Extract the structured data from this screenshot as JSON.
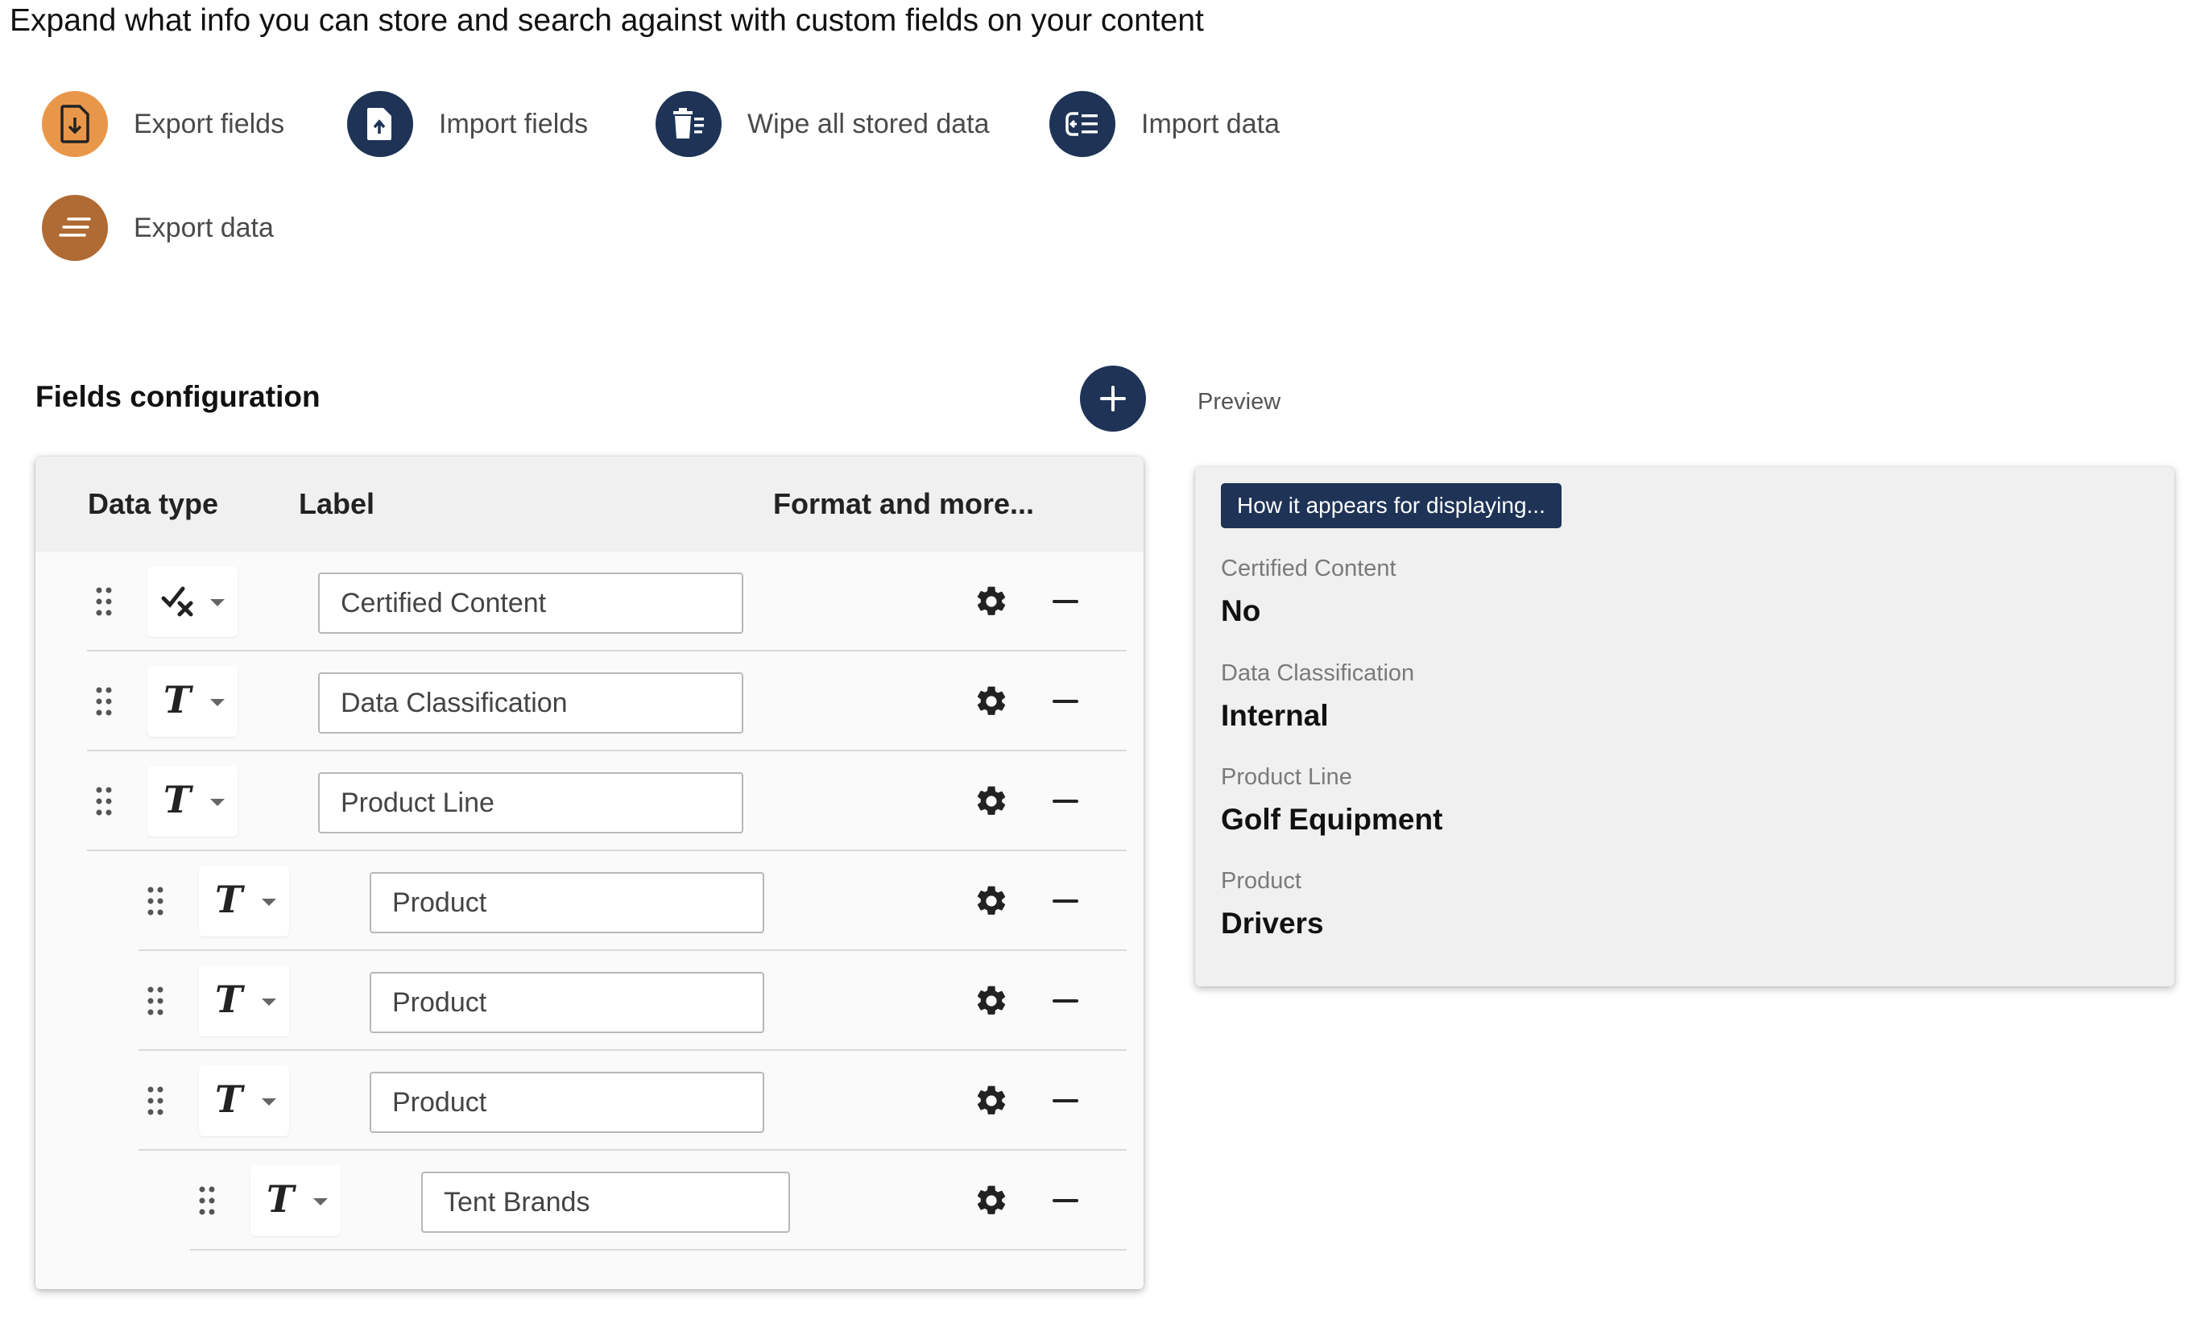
{
  "headline": "Expand what info you can store and search against with custom fields on your content",
  "actions": [
    {
      "label": "Export fields",
      "icon": "file-download-icon",
      "color": "#e8974a"
    },
    {
      "label": "Import fields",
      "icon": "file-upload-icon",
      "color": "#1e3356"
    },
    {
      "label": "Wipe all stored data",
      "icon": "trash-list-icon",
      "color": "#1e3356"
    },
    {
      "label": "Import data",
      "icon": "import-list-icon",
      "color": "#1e3356"
    },
    {
      "label": "Export data",
      "icon": "export-lines-icon",
      "color": "#b06a33"
    }
  ],
  "fields_config": {
    "title": "Fields configuration",
    "add_icon": "plus-icon",
    "columns": {
      "data_type": "Data type",
      "label": "Label",
      "format": "Format and more..."
    },
    "rows": [
      {
        "type_icon": "check-cross-icon",
        "label": "Certified Content",
        "level": 0
      },
      {
        "type_icon": "text-T-icon",
        "label": "Data Classification",
        "level": 0
      },
      {
        "type_icon": "text-T-icon",
        "label": "Product Line",
        "level": 0
      },
      {
        "type_icon": "text-T-icon",
        "label": "Product",
        "level": 1
      },
      {
        "type_icon": "text-T-icon",
        "label": "Product",
        "level": 1
      },
      {
        "type_icon": "text-T-icon",
        "label": "Product",
        "level": 1
      },
      {
        "type_icon": "text-T-icon",
        "label": "Tent Brands",
        "level": 2
      }
    ]
  },
  "preview": {
    "title": "Preview",
    "tag": "How it appears for displaying...",
    "items": [
      {
        "label": "Certified Content",
        "value": "No"
      },
      {
        "label": "Data Classification",
        "value": "Internal"
      },
      {
        "label": "Product Line",
        "value": "Golf Equipment"
      },
      {
        "label": "Product",
        "value": "Drivers"
      }
    ]
  },
  "colors": {
    "navy": "#1e3356",
    "orange": "#e8974a",
    "brown": "#b06a33"
  }
}
